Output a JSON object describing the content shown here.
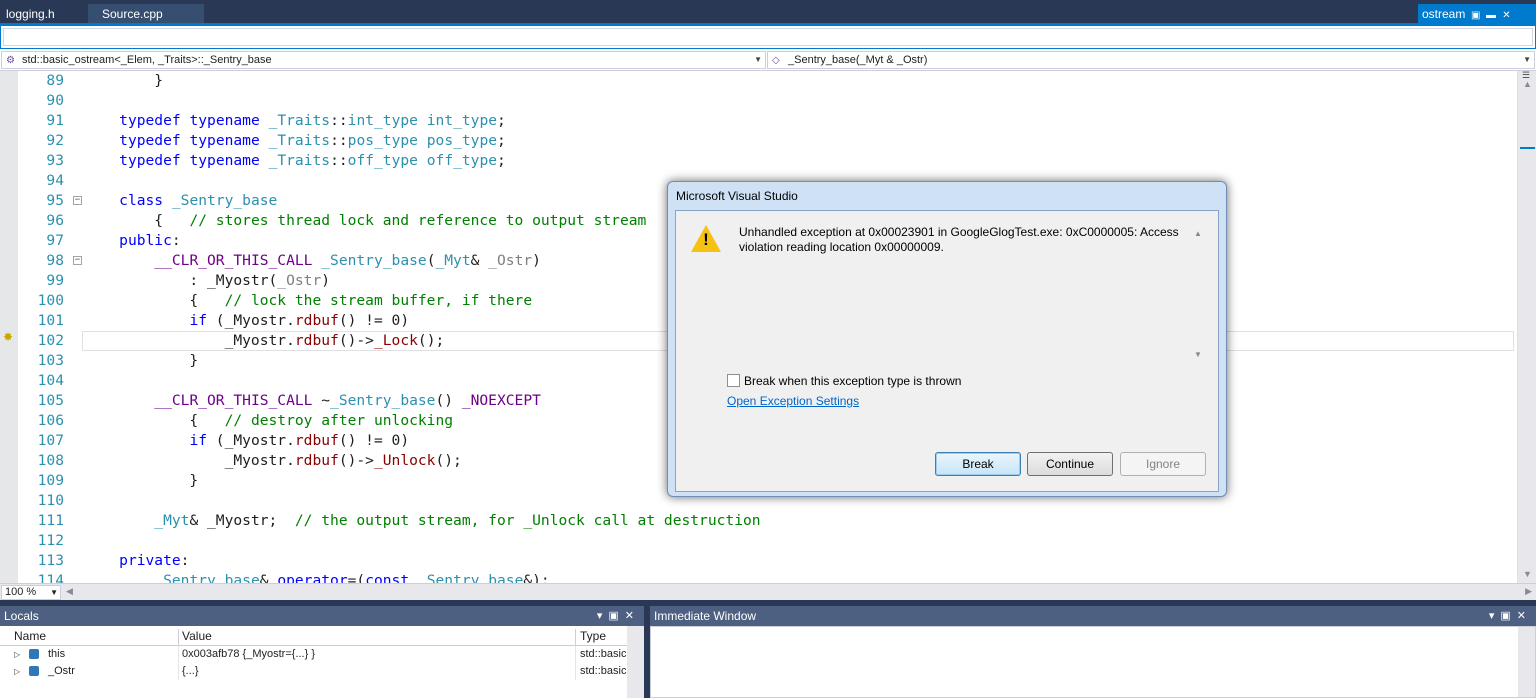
{
  "tabs": {
    "tab1": "logging.h",
    "tab2": "Source.cpp",
    "active": "ostream",
    "active_icons": [
      "pin-icon",
      "float-icon",
      "close-icon"
    ]
  },
  "nav": {
    "left": "std::basic_ostream<_Elem, _Traits>::_Sentry_base",
    "right": "_Sentry_base(_Myt & _Ostr)"
  },
  "code": {
    "lines": [
      {
        "n": "89",
        "text": "        }"
      },
      {
        "n": "90",
        "text": ""
      },
      {
        "n": "91",
        "text": "    typedef typename _Traits::int_type int_type;"
      },
      {
        "n": "92",
        "text": "    typedef typename _Traits::pos_type pos_type;"
      },
      {
        "n": "93",
        "text": "    typedef typename _Traits::off_type off_type;"
      },
      {
        "n": "94",
        "text": ""
      },
      {
        "n": "95",
        "text": "    class _Sentry_base"
      },
      {
        "n": "96",
        "text": "        {   // stores thread lock and reference to output stream"
      },
      {
        "n": "97",
        "text": "    public:"
      },
      {
        "n": "98",
        "text": "        __CLR_OR_THIS_CALL _Sentry_base(_Myt& _Ostr)"
      },
      {
        "n": "99",
        "text": "            : _Myostr(_Ostr)"
      },
      {
        "n": "100",
        "text": "            {   // lock the stream buffer, if there"
      },
      {
        "n": "101",
        "text": "            if (_Myostr.rdbuf() != 0)"
      },
      {
        "n": "102",
        "text": "                _Myostr.rdbuf()->_Lock();"
      },
      {
        "n": "103",
        "text": "            }"
      },
      {
        "n": "104",
        "text": ""
      },
      {
        "n": "105",
        "text": "        __CLR_OR_THIS_CALL ~_Sentry_base() _NOEXCEPT"
      },
      {
        "n": "106",
        "text": "            {   // destroy after unlocking"
      },
      {
        "n": "107",
        "text": "            if (_Myostr.rdbuf() != 0)"
      },
      {
        "n": "108",
        "text": "                _Myostr.rdbuf()->_Unlock();"
      },
      {
        "n": "109",
        "text": "            }"
      },
      {
        "n": "110",
        "text": ""
      },
      {
        "n": "111",
        "text": "        _Myt& _Myostr;  // the output stream, for _Unlock call at destruction"
      },
      {
        "n": "112",
        "text": ""
      },
      {
        "n": "113",
        "text": "    private:"
      },
      {
        "n": "114",
        "text": "        _Sentry_base& operator=(const _Sentry_base&);"
      }
    ],
    "current_line": "102"
  },
  "zoom": "100 %",
  "locals": {
    "title": "Locals",
    "columns": {
      "name": "Name",
      "value": "Value",
      "type": "Type"
    },
    "rows": [
      {
        "name": "this",
        "value": "0x003afb78 {_Myostr={...} }",
        "type": "std::basic"
      },
      {
        "name": "_Ostr",
        "value": "{...}",
        "type": "std::basic"
      }
    ]
  },
  "immediate": {
    "title": "Immediate Window"
  },
  "dialog": {
    "title": "Microsoft Visual Studio",
    "message": "Unhandled exception at 0x00023901 in GoogleGlogTest.exe: 0xC0000005: Access violation reading location 0x00000009.",
    "checkbox_label": "Break when this exception type is thrown",
    "link": "Open Exception Settings",
    "break_label": "Break",
    "continue_label": "Continue",
    "ignore_label": "Ignore"
  }
}
